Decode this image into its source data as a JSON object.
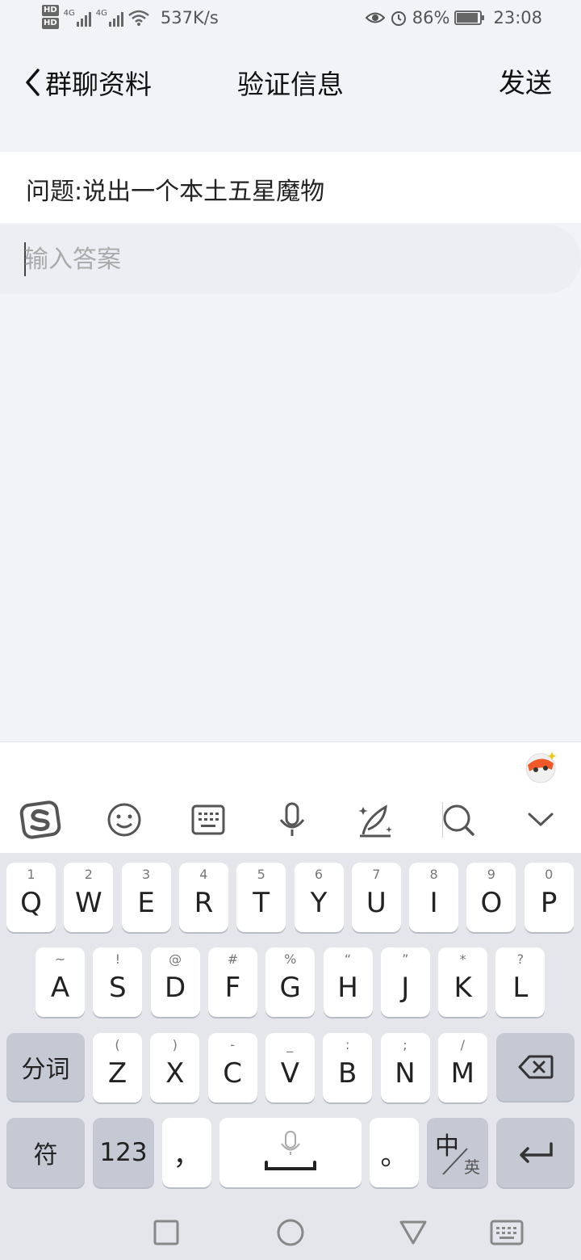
{
  "status_bar": {
    "hd1": "HD",
    "hd2": "HD",
    "net1": "4G",
    "net2": "4G",
    "speed": "537K/s",
    "battery": "86%",
    "battery_level": 0.86,
    "time": "23:08"
  },
  "nav": {
    "back_label": "群聊资料",
    "title": "验证信息",
    "send_label": "发送"
  },
  "question": {
    "text": "问题:说出一个本土五星魔物"
  },
  "answer": {
    "placeholder": "输入答案",
    "value": ""
  },
  "toolbar": {
    "icons": [
      "sogou-logo-icon",
      "emoji-icon",
      "keyboard-icon",
      "microphone-icon",
      "handwriting-icon",
      "search-icon",
      "collapse-icon"
    ]
  },
  "keyboard": {
    "row1": [
      {
        "key": "Q",
        "sub": "1"
      },
      {
        "key": "W",
        "sub": "2"
      },
      {
        "key": "E",
        "sub": "3"
      },
      {
        "key": "R",
        "sub": "4"
      },
      {
        "key": "T",
        "sub": "5"
      },
      {
        "key": "Y",
        "sub": "6"
      },
      {
        "key": "U",
        "sub": "7"
      },
      {
        "key": "I",
        "sub": "8"
      },
      {
        "key": "O",
        "sub": "9"
      },
      {
        "key": "P",
        "sub": "0"
      }
    ],
    "row2": [
      {
        "key": "A",
        "sub": "~"
      },
      {
        "key": "S",
        "sub": "!"
      },
      {
        "key": "D",
        "sub": "@"
      },
      {
        "key": "F",
        "sub": "#"
      },
      {
        "key": "G",
        "sub": "%"
      },
      {
        "key": "H",
        "sub": "“"
      },
      {
        "key": "J",
        "sub": "”"
      },
      {
        "key": "K",
        "sub": "*"
      },
      {
        "key": "L",
        "sub": "?"
      }
    ],
    "row3": [
      {
        "key": "Z",
        "sub": "("
      },
      {
        "key": "X",
        "sub": ")"
      },
      {
        "key": "C",
        "sub": "-"
      },
      {
        "key": "V",
        "sub": "_"
      },
      {
        "key": "B",
        "sub": ":"
      },
      {
        "key": "N",
        "sub": ";"
      },
      {
        "key": "M",
        "sub": "/"
      }
    ],
    "segment_label": "分词",
    "symbol_label": "符",
    "numbers_label": "123",
    "comma": "，",
    "period": "。",
    "lang_main": "中",
    "lang_sub": "英"
  },
  "colors": {
    "background": "#f2f3f7",
    "key": "#ffffff",
    "key_dark": "#c5c9d3",
    "keyboard_bg": "#e4e6ec"
  }
}
